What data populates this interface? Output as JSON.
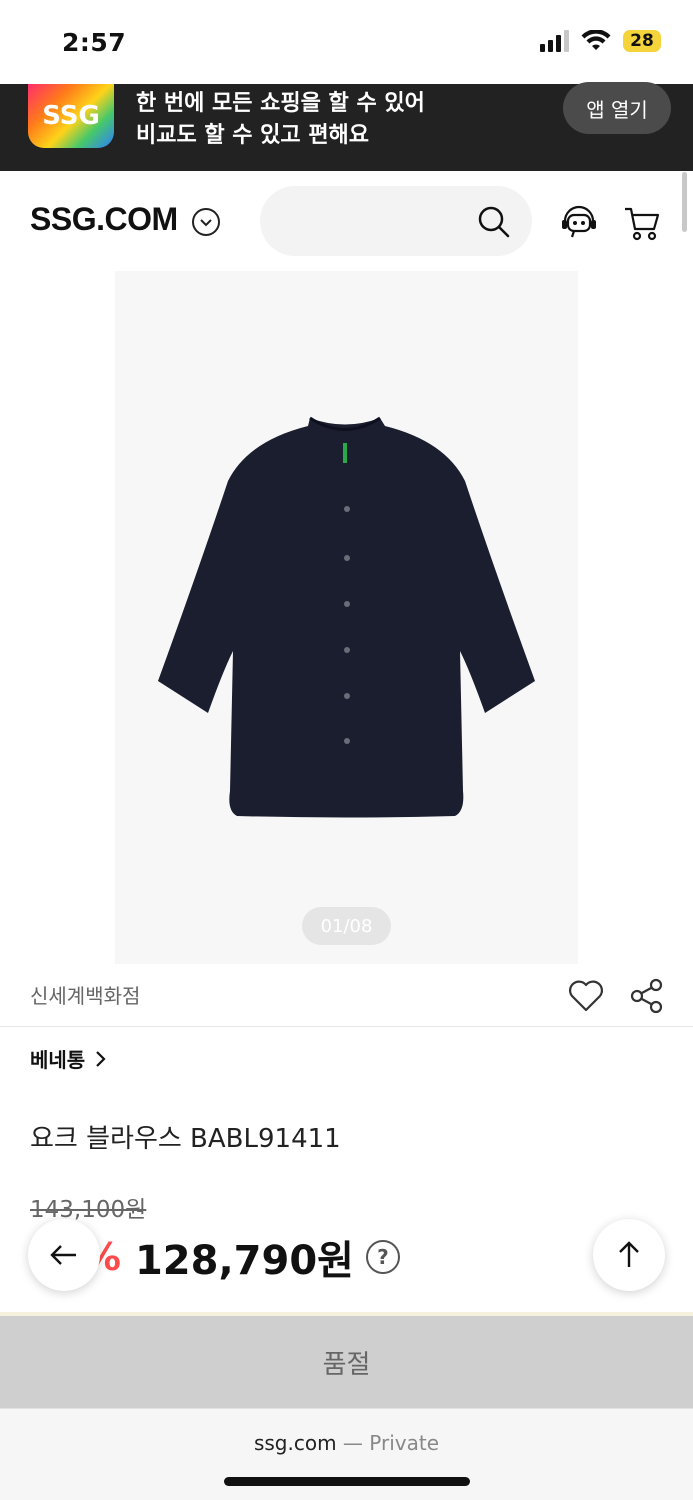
{
  "status_bar": {
    "time": "2:57",
    "battery": "28"
  },
  "app_banner": {
    "logo": "SSG",
    "line1": "한 번에 모든 쇼핑을 할 수 있어",
    "line2": "비교도 할 수 있고 편해요",
    "open_button": "앱 열기"
  },
  "header": {
    "logo": "SSG.COM"
  },
  "product": {
    "image_counter": "01/08",
    "seller": "신세계백화점",
    "brand": "베네통",
    "name": "요크 블라우스 BABL91411",
    "original_price": "143,100원",
    "discount": "10%",
    "sale_price": "128,790원",
    "help_symbol": "?",
    "sold_out_label": "품절"
  },
  "browser": {
    "domain": "ssg.com",
    "separator": " — ",
    "mode": "Private"
  },
  "icons": {
    "search": "search-icon",
    "customer_service": "headset-icon",
    "cart": "cart-icon",
    "like": "heart-icon",
    "share": "share-icon",
    "back": "arrow-left-icon",
    "top": "arrow-up-icon"
  },
  "colors": {
    "banner_bg": "#222222",
    "discount": "#ff4b4b",
    "sold_out_bg": "#cfcfcf"
  }
}
